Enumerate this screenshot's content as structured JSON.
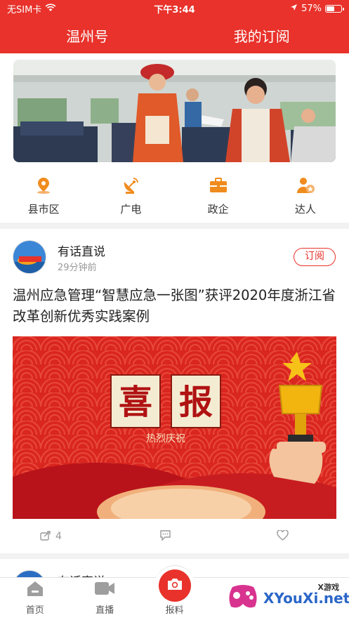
{
  "status_bar": {
    "carrier": "无SIM卡",
    "time": "下午3:44",
    "battery": "57%",
    "battery_level": 0.57
  },
  "top_nav": {
    "tabs": [
      {
        "label": "温州号"
      },
      {
        "label": "我的订阅"
      }
    ]
  },
  "categories": [
    {
      "label": "县市区",
      "icon": "location-pin-icon"
    },
    {
      "label": "广电",
      "icon": "satellite-dish-icon"
    },
    {
      "label": "政企",
      "icon": "briefcase-icon"
    },
    {
      "label": "达人",
      "icon": "star-person-icon"
    }
  ],
  "post": {
    "author": "有话直说",
    "time": "29分钟前",
    "subscribe_label": "订阅",
    "headline": "温州应急管理“智慧应急一张图”获评2020年度浙江省改革创新优秀实践案例",
    "image_text": {
      "line1": "喜",
      "line2": "报",
      "subtitle": "热烈庆祝"
    },
    "share_count": "4"
  },
  "post2": {
    "author": "有话直说"
  },
  "tab_bar": {
    "tabs": [
      {
        "label": "首页"
      },
      {
        "label": "直播"
      },
      {
        "label": "报料"
      }
    ]
  },
  "watermark": {
    "text": "XYouXi.net",
    "small": "X游戏"
  },
  "colors": {
    "brand_red": "#e8322b",
    "icon_orange": "#f08c1e"
  }
}
